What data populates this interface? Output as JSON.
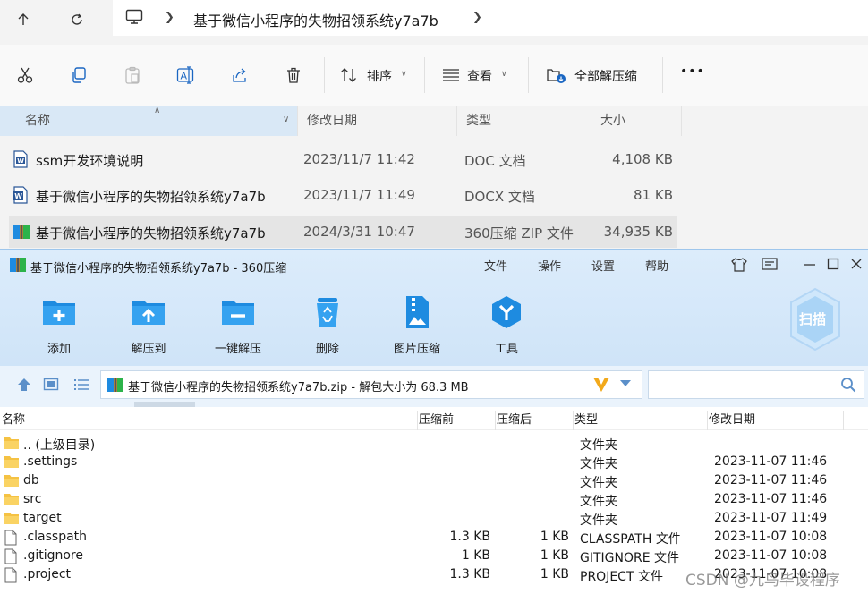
{
  "explorer": {
    "breadcrumb": "基于微信小程序的失物招领系统y7a7b",
    "commands": {
      "sort": "排序",
      "view": "查看",
      "extract_all": "全部解压缩",
      "more": "•••"
    },
    "columns": {
      "name": "名称",
      "date": "修改日期",
      "type": "类型",
      "size": "大小"
    },
    "files": [
      {
        "name": "ssm开发环境说明",
        "date": "2023/11/7 11:42",
        "type": "DOC 文档",
        "size": "4,108 KB",
        "icon": "word-doc-icon"
      },
      {
        "name": "基于微信小程序的失物招领系统y7a7b",
        "date": "2023/11/7 11:49",
        "type": "DOCX 文档",
        "size": "81 KB",
        "icon": "word-docx-icon"
      },
      {
        "name": "基于微信小程序的失物招领系统y7a7b",
        "date": "2024/3/31 10:47",
        "type": "360压缩 ZIP 文件",
        "size": "34,935 KB",
        "icon": "zip-archive-icon"
      }
    ]
  },
  "zip": {
    "title": "基于微信小程序的失物招领系统y7a7b - 360压缩",
    "menu": [
      "文件",
      "操作",
      "设置",
      "帮助"
    ],
    "toolbar": [
      {
        "label": "添加",
        "icon": "add-folder-icon"
      },
      {
        "label": "解压到",
        "icon": "extract-to-icon"
      },
      {
        "label": "一键解压",
        "icon": "one-click-extract-icon"
      },
      {
        "label": "删除",
        "icon": "recycle-bin-icon"
      },
      {
        "label": "图片压缩",
        "icon": "image-compress-icon"
      },
      {
        "label": "工具",
        "icon": "tools-icon"
      }
    ],
    "scan_label": "扫描",
    "path": "基于微信小程序的失物招领系统y7a7b.zip - 解包大小为 68.3 MB",
    "search_placeholder": "",
    "columns": {
      "name": "名称",
      "before": "压缩前",
      "after": "压缩后",
      "type": "类型",
      "date": "修改日期"
    },
    "rows": [
      {
        "name": ".. (上级目录)",
        "before": "",
        "after": "",
        "type": "文件夹",
        "date": "",
        "icon": "folder-icon"
      },
      {
        "name": ".settings",
        "before": "",
        "after": "",
        "type": "文件夹",
        "date": "2023-11-07 11:46",
        "icon": "folder-icon"
      },
      {
        "name": "db",
        "before": "",
        "after": "",
        "type": "文件夹",
        "date": "2023-11-07 11:46",
        "icon": "folder-icon"
      },
      {
        "name": "src",
        "before": "",
        "after": "",
        "type": "文件夹",
        "date": "2023-11-07 11:46",
        "icon": "folder-icon"
      },
      {
        "name": "target",
        "before": "",
        "after": "",
        "type": "文件夹",
        "date": "2023-11-07 11:49",
        "icon": "folder-icon"
      },
      {
        "name": ".classpath",
        "before": "1.3 KB",
        "after": "1 KB",
        "type": "CLASSPATH 文件",
        "date": "2023-11-07 10:08",
        "icon": "file-icon"
      },
      {
        "name": ".gitignore",
        "before": "1 KB",
        "after": "1 KB",
        "type": "GITIGNORE 文件",
        "date": "2023-11-07 10:08",
        "icon": "file-icon"
      },
      {
        "name": ".project",
        "before": "1.3 KB",
        "after": "1 KB",
        "type": "PROJECT 文件",
        "date": "2023-11-07 10:08",
        "icon": "file-icon"
      }
    ]
  },
  "watermark": "CSDN @九鸟毕设程序",
  "colors": {
    "selection": "#e5e5e5",
    "name_column": "#d9e8f6",
    "zip_header": "#dcecfb",
    "folder": "#f5c243",
    "zip_blue": "#1e8be0"
  }
}
